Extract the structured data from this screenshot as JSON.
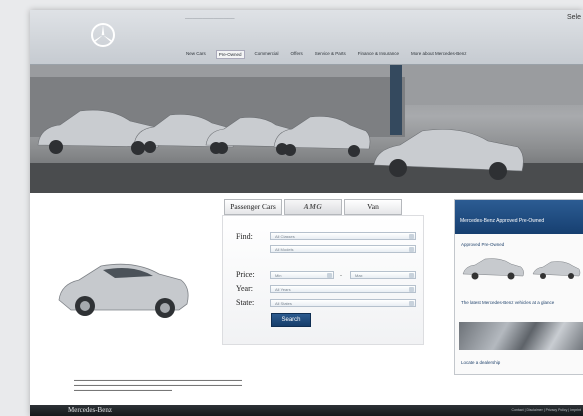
{
  "header": {
    "util_link": "Sele"
  },
  "nav": {
    "items": [
      {
        "label": "New Cars",
        "active": false
      },
      {
        "label": "Pre-Owned",
        "active": true
      },
      {
        "label": "Commercial",
        "active": false
      },
      {
        "label": "Offers",
        "active": false
      },
      {
        "label": "Service & Parts",
        "active": false
      },
      {
        "label": "Finance & Insurance",
        "active": false
      },
      {
        "label": "More about Mercedes-Benz",
        "active": false
      }
    ]
  },
  "search": {
    "tabs": [
      "Passenger Cars",
      "AMG",
      "Van"
    ],
    "labels": {
      "find": "Find:",
      "price": "Price:",
      "year": "Year:",
      "state": "State:"
    },
    "selects": {
      "class": "All Classes",
      "model": "All Models",
      "price_min": "Min",
      "price_max": "Max",
      "year": "All Years",
      "state": "All States"
    },
    "range_dash": "-",
    "button": "Search"
  },
  "sidebar": {
    "title": "Mercedes-Benz Approved Pre-Owned",
    "link_1": "Approved Pre-Owned",
    "link_2": "The latest Mercedes-Benz vehicles at a glance",
    "link_3": "Locate a dealership"
  },
  "footer": {
    "brand": "Mercedes-Benz",
    "links": "Contact | Disclaimer | Privacy Policy | Imprint"
  },
  "colors": {
    "accent": "#1f4a7d",
    "footer_bg": "#1b1f22",
    "header_bg": "#cfd3d8"
  }
}
